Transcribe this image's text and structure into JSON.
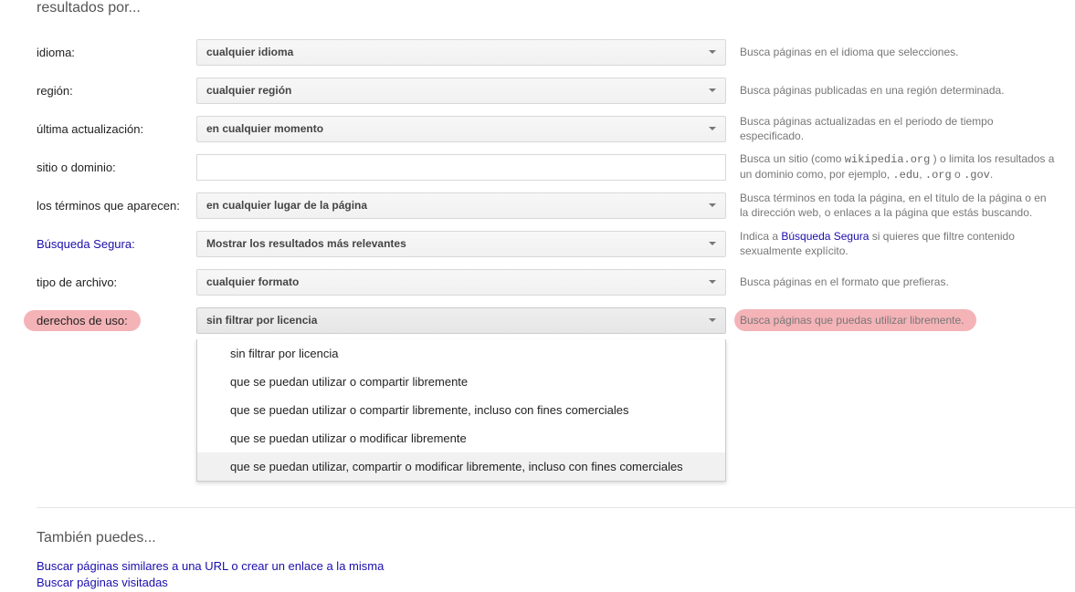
{
  "section_title": "resultados por...",
  "rows": {
    "idioma": {
      "label": "idioma:",
      "value": "cualquier idioma",
      "help": "Busca páginas en el idioma que selecciones."
    },
    "region": {
      "label": "región:",
      "value": "cualquier región",
      "help": "Busca páginas publicadas en una región determinada."
    },
    "update": {
      "label": "última actualización:",
      "value": "en cualquier momento",
      "help": "Busca páginas actualizadas en el periodo de tiempo especificado."
    },
    "site": {
      "label": "sitio o dominio:",
      "value": "",
      "help_pre": "Busca un sitio (como ",
      "help_code1": "wikipedia.org",
      "help_mid": " ) o limita los resultados a un dominio como, por ejemplo, ",
      "help_code2": ".edu",
      "help_sep1": ", ",
      "help_code3": ".org",
      "help_sep2": " o ",
      "help_code4": ".gov",
      "help_post": "."
    },
    "terms": {
      "label": "los términos que aparecen:",
      "value": "en cualquier lugar de la página",
      "help": "Busca términos en toda la página, en el título de la página o en la dirección web, o enlaces a la página que estás buscando."
    },
    "safesearch": {
      "label": "Búsqueda Segura:",
      "value": "Mostrar los resultados más relevantes",
      "help_pre": "Indica a ",
      "help_link": "Búsqueda Segura",
      "help_post": " si quieres que filtre contenido sexualmente explícito."
    },
    "filetype": {
      "label": "tipo de archivo:",
      "value": "cualquier formato",
      "help": "Busca páginas en el formato que prefieras."
    },
    "rights": {
      "label": "derechos de uso:",
      "value": "sin filtrar por licencia",
      "help": "Busca páginas que puedas utilizar libremente."
    }
  },
  "rights_options": [
    "sin filtrar por licencia",
    "que se puedan utilizar o compartir libremente",
    "que se puedan utilizar o compartir libremente, incluso con fines comerciales",
    "que se puedan utilizar o modificar libremente",
    "que se puedan utilizar, compartir o modificar libremente, incluso con fines comerciales"
  ],
  "also_title": "También puedes...",
  "also_links": [
    "Buscar páginas similares a una URL o crear un enlace a la misma",
    "Buscar páginas visitadas"
  ]
}
